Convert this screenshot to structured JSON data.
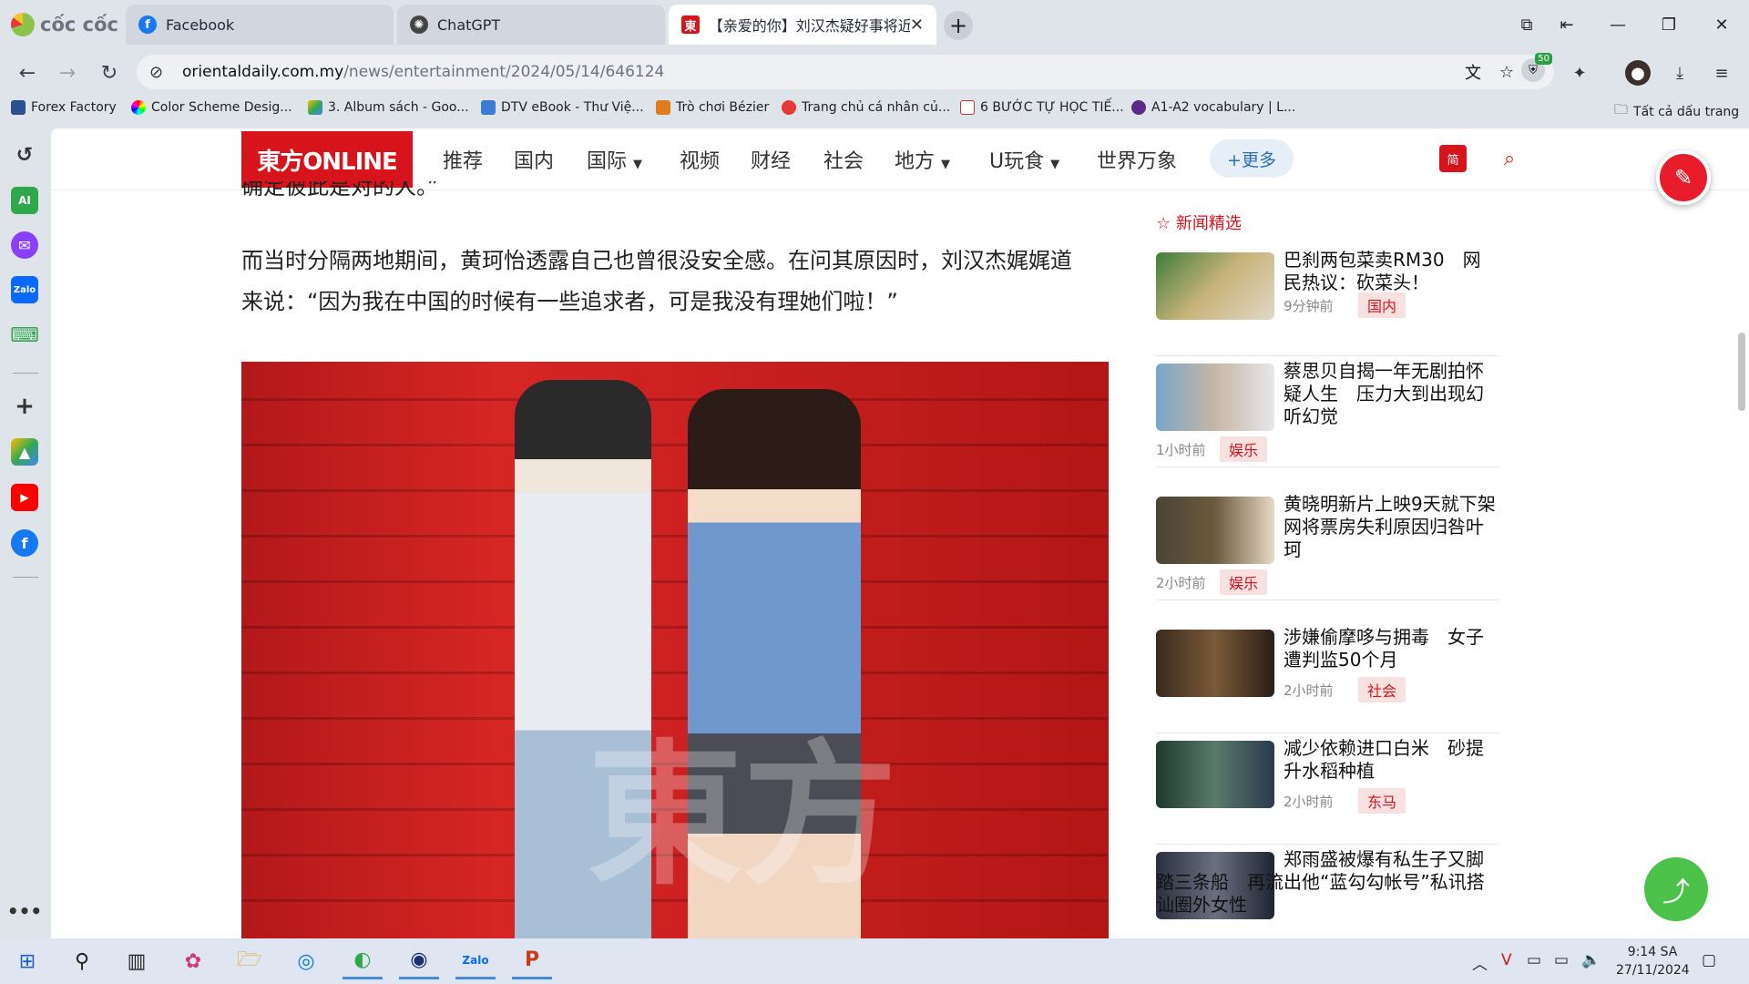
{
  "browser": {
    "brand": "cốc cốc",
    "tabs": [
      {
        "label": "Facebook",
        "icon": "facebook-icon",
        "active": false
      },
      {
        "label": "ChatGPT",
        "icon": "chatgpt-icon",
        "active": false
      },
      {
        "label": "【亲爱的你】刘汉杰疑好事将近",
        "icon": "orientaldaily-icon",
        "active": true
      }
    ],
    "url_host": "orientaldaily.com.my",
    "url_path": "/news/entertainment/2024/05/14/646124",
    "extension_badge": "50",
    "bookmarks": [
      "Forex Factory",
      "Color Scheme Desig...",
      "3. Album sách - Goo...",
      "DTV eBook - Thư Việ...",
      "Trò chơi Bézier",
      "Trang chủ cá nhân củ...",
      "6 BƯỚC TỰ HỌC TIẾ...",
      "A1-A2 vocabulary | L..."
    ],
    "all_bookmarks": "Tất cả dấu trang"
  },
  "site": {
    "logo_text": "東方ONLINE",
    "menu": [
      "推荐",
      "国内",
      "国际",
      "视频",
      "财经",
      "社会",
      "地方",
      "U玩食",
      "世界万象"
    ],
    "more_label": "+更多",
    "lang_label": "简"
  },
  "article": {
    "prev_line": "确定彼此是对的人。”",
    "para_line1": "而当时分隔两地期间，黄珂怡透露自己也曾很没安全感。在问其原因时，刘汉杰娓娓道",
    "para_line2": "来说：“因为我在中国的时候有一些追求者，可是我没有理她们啦！”",
    "watermark": "東方"
  },
  "news": {
    "section_title": "新闻精选",
    "items": [
      {
        "title": "巴刹两包菜卖RM30　网民热议：砍菜头！",
        "time": "9分钟前",
        "tag": "国内"
      },
      {
        "title": "蔡思贝自揭一年无剧拍怀疑人生　压力大到出现幻听幻觉",
        "time": "1小时前",
        "tag": "娱乐"
      },
      {
        "title": "黄晓明新片上映9天就下架　网将票房失利原因归咎叶珂",
        "time": "2小时前",
        "tag": "娱乐"
      },
      {
        "title": "涉嫌偷摩哆与拥毒　女子遭判监50个月",
        "time": "2小时前",
        "tag": "社会"
      },
      {
        "title": "减少依赖进口白米　砂提升水稻种植",
        "time": "2小时前",
        "tag": "东马"
      },
      {
        "title": "郑雨盛被爆有私生子又脚踏三条船　再流出他“蓝勾勾帐号”私讯搭讪圈外女性",
        "time": "",
        "tag": ""
      }
    ]
  },
  "taskbar": {
    "time": "9:14 SA",
    "date": "27/11/2024"
  }
}
